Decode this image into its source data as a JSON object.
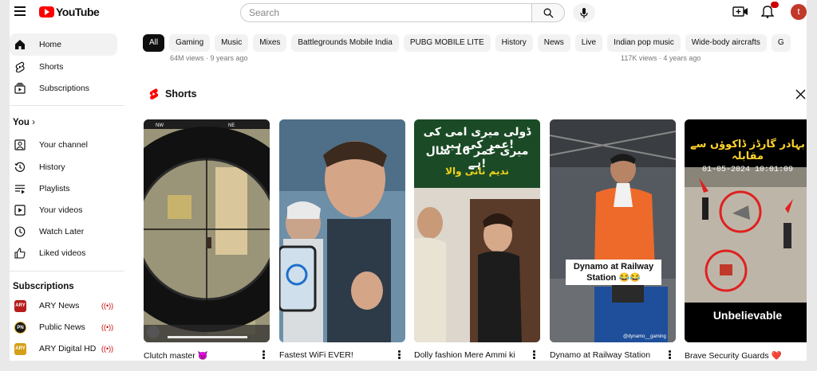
{
  "header": {
    "logo_text": "YouTube",
    "search_placeholder": "Search",
    "notification_count": "9+",
    "avatar_letter": "t"
  },
  "sidebar": {
    "main": [
      {
        "label": "Home",
        "icon": "home-icon"
      },
      {
        "label": "Shorts",
        "icon": "shorts-icon"
      },
      {
        "label": "Subscriptions",
        "icon": "subscriptions-icon"
      }
    ],
    "you_heading": "You",
    "you_items": [
      {
        "label": "Your channel",
        "icon": "your-channel-icon"
      },
      {
        "label": "History",
        "icon": "history-icon"
      },
      {
        "label": "Playlists",
        "icon": "playlists-icon"
      },
      {
        "label": "Your videos",
        "icon": "your-videos-icon"
      },
      {
        "label": "Watch Later",
        "icon": "watch-later-icon"
      },
      {
        "label": "Liked videos",
        "icon": "liked-videos-icon"
      }
    ],
    "subscriptions_heading": "Subscriptions",
    "subscriptions": [
      {
        "label": "ARY News",
        "logo_color": "#b71c1c"
      },
      {
        "label": "Public News",
        "logo_color": "#1a1a1a"
      },
      {
        "label": "ARY Digital HD",
        "logo_color": "#d4a017"
      }
    ]
  },
  "chips": [
    "All",
    "Gaming",
    "Music",
    "Mixes",
    "Battlegrounds Mobile India",
    "PUBG MOBILE LITE",
    "History",
    "News",
    "Live",
    "Indian pop music",
    "Wide-body aircrafts",
    "G"
  ],
  "partial_meta": [
    "64M views · 9 years ago",
    "117K views · 4 years ago"
  ],
  "shorts": {
    "heading": "Shorts",
    "items": [
      {
        "title": "Clutch master 😈"
      },
      {
        "title": "Fastest WiFi EVER!"
      },
      {
        "title": "Dolly fashion Mere Ammi ki"
      },
      {
        "title": "Dynamo at Railway Station"
      },
      {
        "title": "Brave Security Guards ❤️"
      }
    ],
    "overlays": {
      "s3_line1": "ڈولی میری امی کی عمر کی ہیں!",
      "s3_line2": "میری عمر 16 سال ہے!",
      "s3_line3": "ندیم نانی والا",
      "s4_caption_line1": "Dynamo at Railway",
      "s4_caption_line2": "Station 😂😂",
      "s4_handle": "@dynamo__gaming",
      "s5_line1": "بہادر گارڈز ڈاکوؤں سے مقابلہ",
      "s5_timestamp": "01-05-2024 10:01:09",
      "s5_caption": "Unbelievable"
    }
  },
  "colors": {
    "brand_red": "#ff0000",
    "live_red": "#cc0000",
    "chip_bg": "#f2f2f2",
    "chip_active_bg": "#0f0f0f"
  }
}
